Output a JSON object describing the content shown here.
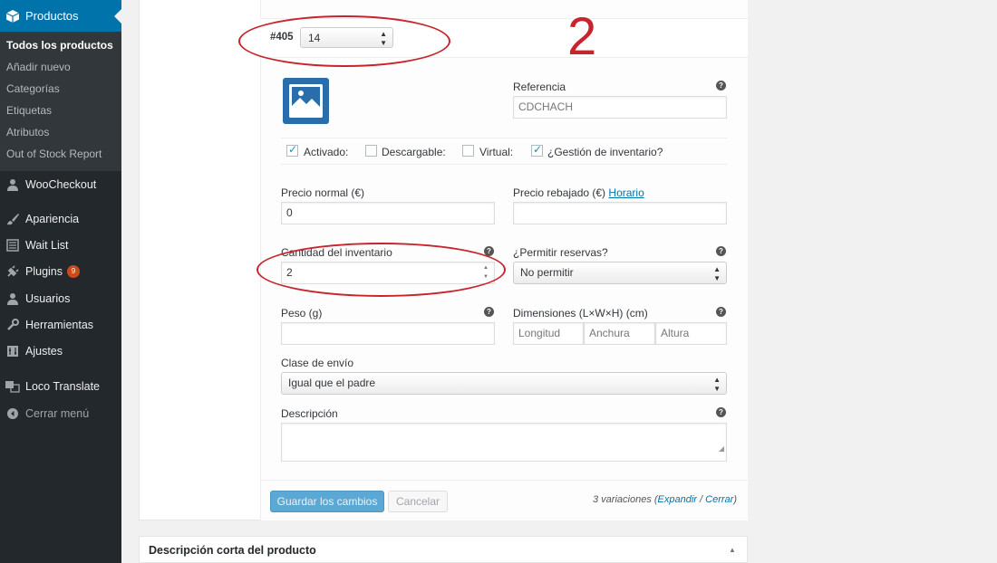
{
  "sidebar": {
    "active_menu": "Productos",
    "submenu": [
      "Todos los productos",
      "Añadir nuevo",
      "Categorías",
      "Etiquetas",
      "Atributos",
      "Out of Stock Report"
    ],
    "items": [
      {
        "label": "WooCheckout",
        "icon": "people-icon"
      },
      {
        "label": "Apariencia",
        "icon": "brush-icon"
      },
      {
        "label": "Wait List",
        "icon": "list-icon"
      },
      {
        "label": "Plugins",
        "icon": "plugin-icon",
        "badge": "9"
      },
      {
        "label": "Usuarios",
        "icon": "user-icon"
      },
      {
        "label": "Herramientas",
        "icon": "wrench-icon"
      },
      {
        "label": "Ajustes",
        "icon": "settings-icon"
      },
      {
        "label": "Loco Translate",
        "icon": "translate-icon"
      },
      {
        "label": "Cerrar menú",
        "icon": "collapse-icon"
      }
    ]
  },
  "variation": {
    "id": "#405",
    "selected_value": "14",
    "annotation_number": "2",
    "referencia_label": "Referencia",
    "referencia_value": "CDCHACH",
    "checkboxes": [
      {
        "label": "Activado:",
        "checked": true
      },
      {
        "label": "Descargable:",
        "checked": false
      },
      {
        "label": "Virtual:",
        "checked": false
      },
      {
        "label": "¿Gestión de inventario?",
        "checked": true
      }
    ],
    "precio_normal_label": "Precio normal (€)",
    "precio_normal_value": "0",
    "precio_rebajado_label": "Precio rebajado (€)",
    "horario_link": "Horario",
    "cantidad_label": "Cantidad del inventario",
    "cantidad_value": "2",
    "reservas_label": "¿Permitir reservas?",
    "reservas_value": "No permitir",
    "peso_label": "Peso (g)",
    "dimensiones_label": "Dimensiones (L×W×H) (cm)",
    "longitud_placeholder": "Longitud",
    "anchura_placeholder": "Anchura",
    "altura_placeholder": "Altura",
    "clase_envio_label": "Clase de envío",
    "clase_envio_value": "Igual que el padre",
    "descripcion_label": "Descripción"
  },
  "footer": {
    "save_label": "Guardar los cambios",
    "cancel_label": "Cancelar",
    "count_prefix": "3 variaciones (",
    "expand_link": "Expandir",
    "separator": " / ",
    "close_link": "Cerrar",
    "count_suffix": ")"
  },
  "short_description": {
    "title": "Descripción corta del producto"
  },
  "colors": {
    "sidebar_bg": "#23282d",
    "active_menu_bg": "#0073aa",
    "annotation_red": "#c8242d",
    "primary_button": "#5ba8d4"
  }
}
